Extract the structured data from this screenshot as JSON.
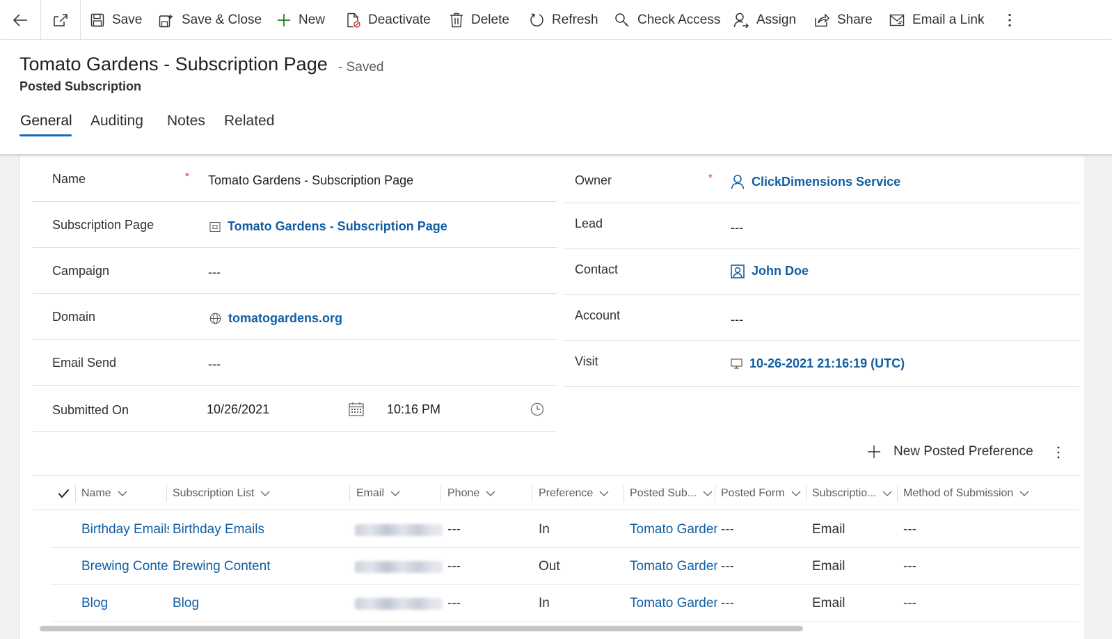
{
  "toolbar": {
    "save": "Save",
    "save_close": "Save & Close",
    "new": "New",
    "deactivate": "Deactivate",
    "delete": "Delete",
    "refresh": "Refresh",
    "check_access": "Check Access",
    "assign": "Assign",
    "share": "Share",
    "email_link": "Email a Link"
  },
  "header": {
    "title": "Tomato Gardens - Subscription Page",
    "status": "- Saved",
    "entity": "Posted Subscription",
    "tabs": [
      "General",
      "Auditing",
      "Notes",
      "Related"
    ],
    "active_tab": "General"
  },
  "form": {
    "left": [
      {
        "label": "Name",
        "value": "Tomato Gardens - Subscription Page"
      },
      {
        "label": "Subscription Page",
        "value": "Tomato Gardens - Subscription Page"
      },
      {
        "label": "Campaign",
        "value": "---"
      },
      {
        "label": "Domain",
        "value": "tomatogardens.org"
      },
      {
        "label": "Email Send",
        "value": "---"
      }
    ],
    "submitted": {
      "label": "Submitted On",
      "date": "10/26/2021",
      "time": "10:16 PM"
    },
    "right": [
      {
        "label": "Owner",
        "value": "ClickDimensions Service"
      },
      {
        "label": "Lead",
        "value": "---"
      },
      {
        "label": "Contact",
        "value": "John Doe"
      },
      {
        "label": "Account",
        "value": "---"
      },
      {
        "label": "Visit",
        "value": "10-26-2021 21:16:19 (UTC)"
      }
    ],
    "required_mark": "*"
  },
  "grid": {
    "new_button": "New Posted Preference",
    "columns": [
      "Name",
      "Subscription List",
      "Email",
      "Phone",
      "Preference",
      "Posted Sub...",
      "Posted Form",
      "Subscriptio...",
      "Method of Submission"
    ],
    "rows": [
      {
        "name": "Birthday Emails",
        "list": "Birthday Emails",
        "phone": "---",
        "preference": "In",
        "posted_sub": "Tomato Gardens - Subscription Page",
        "posted_form": "---",
        "subscription": "Email",
        "method": "---"
      },
      {
        "name": "Brewing Content",
        "list": "Brewing Content",
        "phone": "---",
        "preference": "Out",
        "posted_sub": "Tomato Gardens - Subscription Page",
        "posted_form": "---",
        "subscription": "Email",
        "method": "---"
      },
      {
        "name": "Blog",
        "list": "Blog",
        "phone": "---",
        "preference": "In",
        "posted_sub": "Tomato Gardens - Subscription Page",
        "posted_form": "---",
        "subscription": "Email",
        "method": "---"
      }
    ]
  },
  "icons": [
    "back-arrow-icon",
    "popout-icon",
    "save-icon",
    "save-close-icon",
    "plus-icon",
    "deactivate-icon",
    "delete-icon",
    "refresh-icon",
    "check-access-icon",
    "assign-icon",
    "share-icon",
    "email-link-icon",
    "more-vertical-icon",
    "page-icon",
    "globe-icon",
    "user-icon",
    "contact-icon",
    "monitor-icon",
    "calendar-icon",
    "clock-icon",
    "checkmark-icon",
    "chevron-down-icon"
  ],
  "colors": {
    "link": "#115ea3",
    "accent": "#0f6cbd",
    "required": "#d13438",
    "new_plus": "#107c10"
  }
}
